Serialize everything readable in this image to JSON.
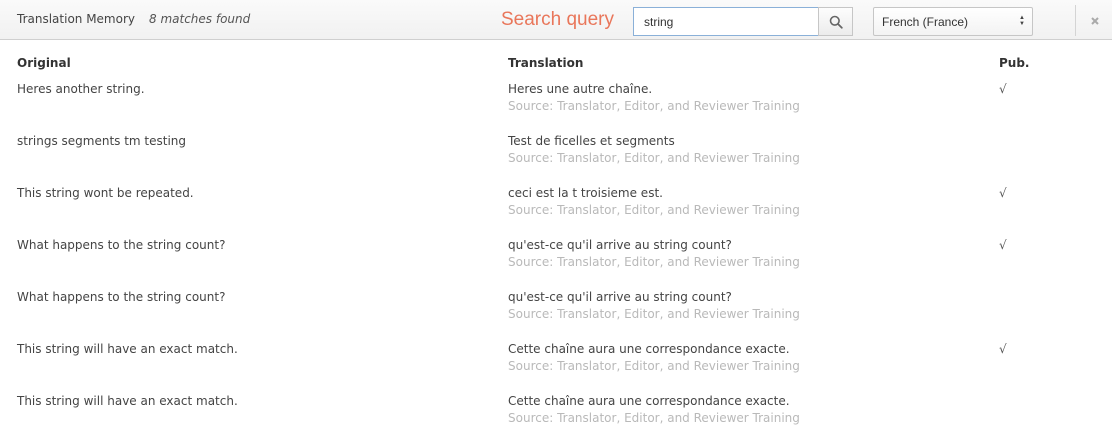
{
  "toolbar": {
    "title": "Translation Memory",
    "match_count": "8 matches found",
    "search_label": "Search query",
    "search_value": "string",
    "language": "French (France)",
    "accent_color": "#e9765a"
  },
  "table": {
    "headers": {
      "original": "Original",
      "translation": "Translation",
      "pub": "Pub."
    },
    "rows": [
      {
        "original": "Heres another string.",
        "translation": "Heres une autre chaîne.",
        "source": "Source: Translator, Editor, and Reviewer Training",
        "pub": "√"
      },
      {
        "original": "strings segments tm testing",
        "translation": "Test de ficelles et segments",
        "source": "Source: Translator, Editor, and Reviewer Training",
        "pub": ""
      },
      {
        "original": "This string wont be repeated.",
        "translation": "ceci est la t troisieme est.",
        "source": "Source: Translator, Editor, and Reviewer Training",
        "pub": "√"
      },
      {
        "original": "What happens to the string count?",
        "translation": "qu'est-ce qu'il arrive au string count?",
        "source": "Source: Translator, Editor, and Reviewer Training",
        "pub": "√"
      },
      {
        "original": "What happens to the string count?",
        "translation": "qu'est-ce qu'il arrive au string count?",
        "source": "Source: Translator, Editor, and Reviewer Training",
        "pub": ""
      },
      {
        "original": "This string will have an exact match.",
        "translation": "Cette chaîne aura une correspondance exacte.",
        "source": "Source: Translator, Editor, and Reviewer Training",
        "pub": "√"
      },
      {
        "original": "This string will have an exact match.",
        "translation": "Cette chaîne aura une correspondance exacte.",
        "source": "Source: Translator, Editor, and Reviewer Training",
        "pub": ""
      }
    ]
  }
}
